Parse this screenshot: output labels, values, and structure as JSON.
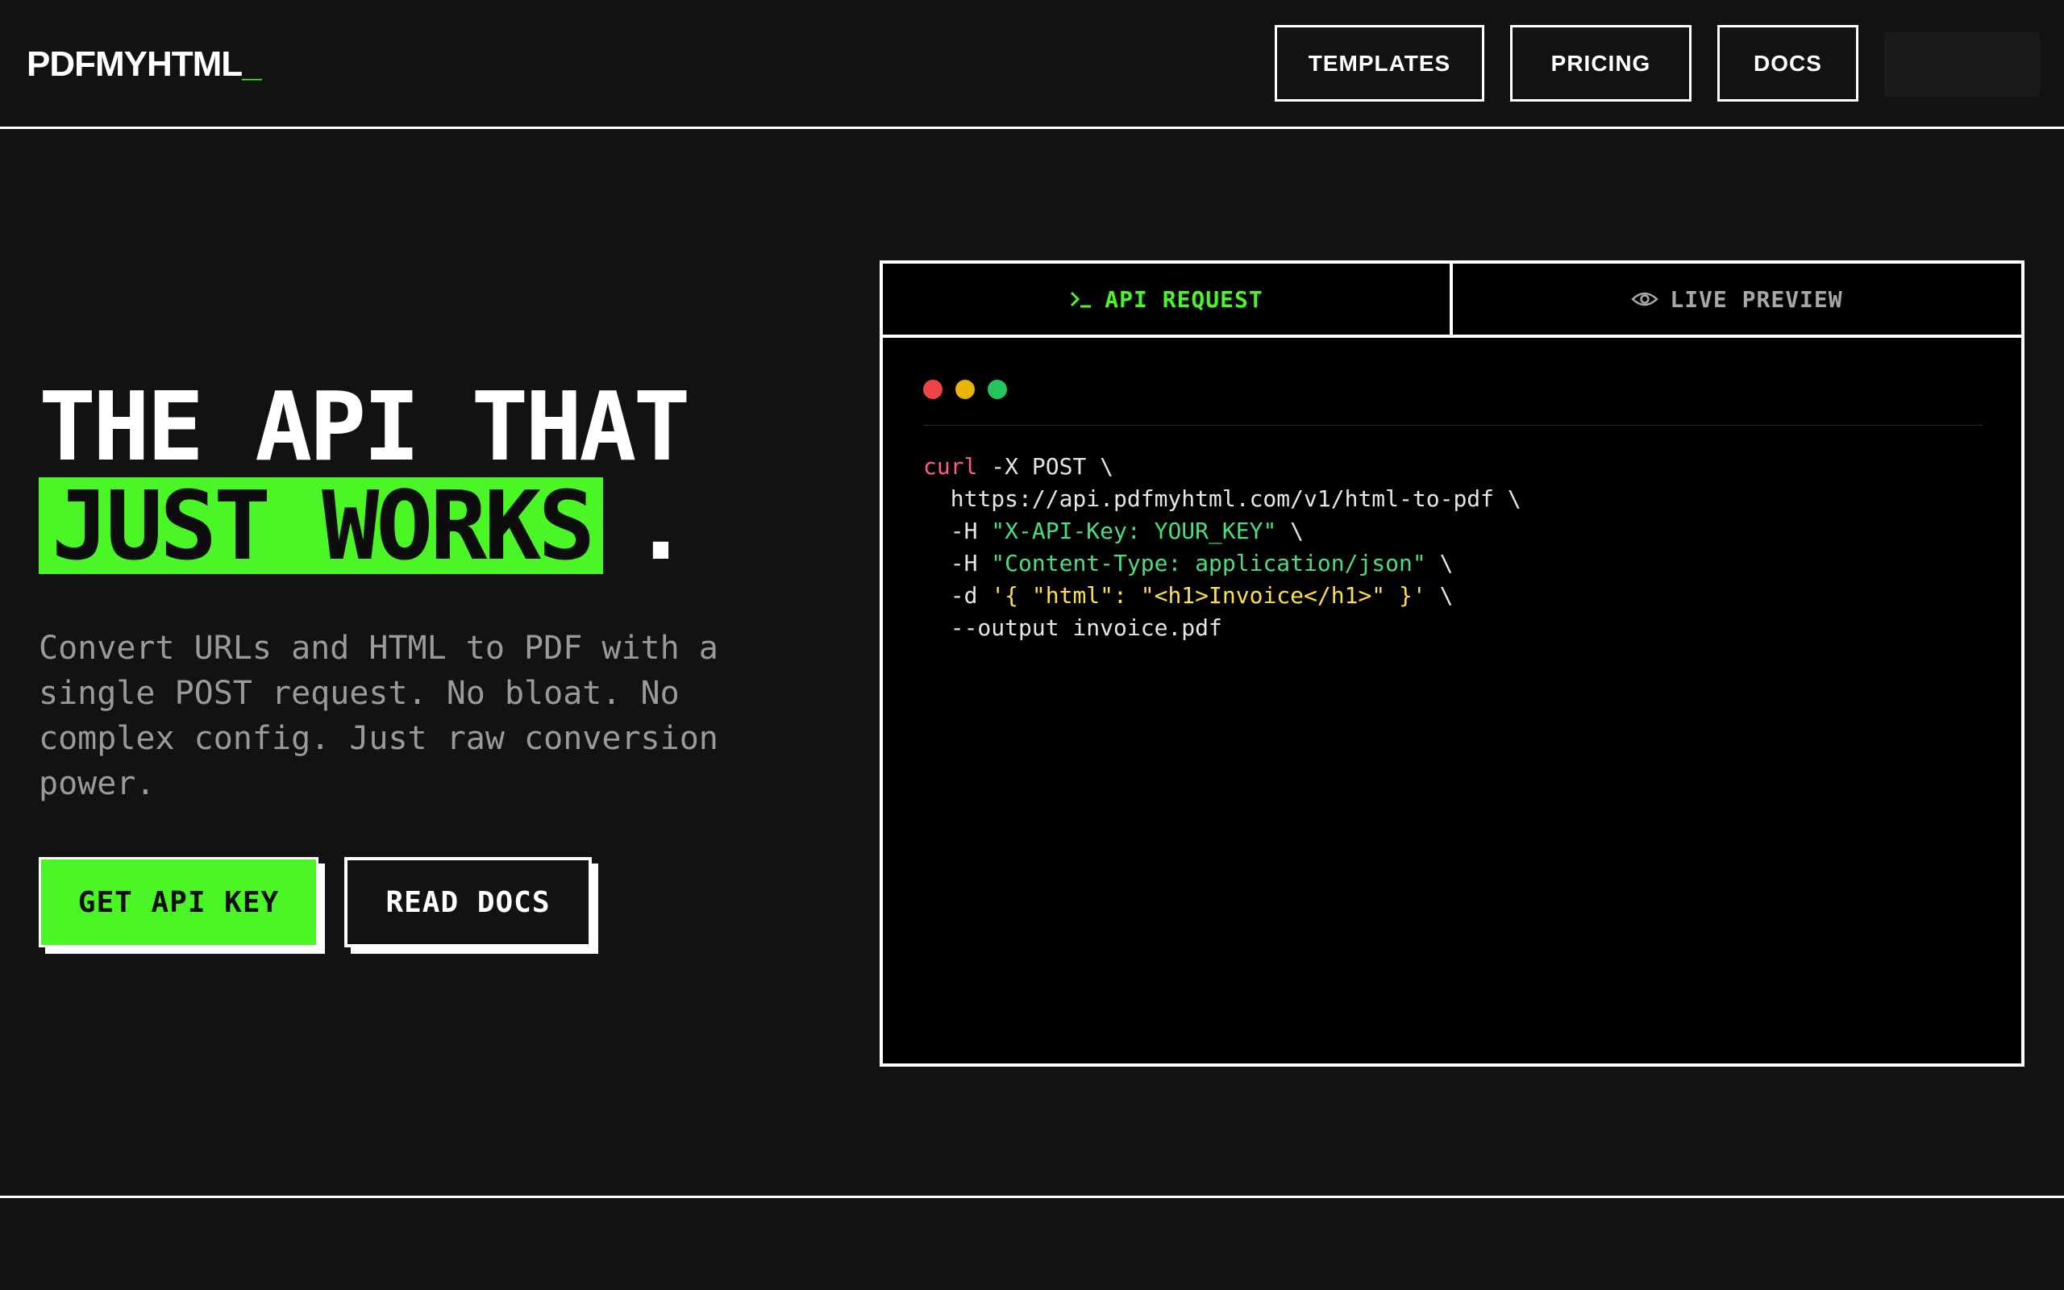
{
  "header": {
    "logo_text": "PDFMYHTML",
    "logo_cursor": "_",
    "nav": [
      "TEMPLATES",
      "PRICING",
      "DOCS"
    ]
  },
  "hero": {
    "headline_line1": "THE API THAT",
    "headline_highlight": "JUST WORKS",
    "headline_dot": ".",
    "subtext": "Convert URLs and HTML to PDF with a single POST request. No bloat. No complex config. Just raw conversion power.",
    "primary_cta": "GET API KEY",
    "secondary_cta": "READ DOCS"
  },
  "panel": {
    "tabs": [
      {
        "label": "API REQUEST",
        "icon": "terminal-icon",
        "active": true
      },
      {
        "label": "LIVE PREVIEW",
        "icon": "eye-icon",
        "active": false
      }
    ],
    "window_dots": [
      "#ef4444",
      "#eab308",
      "#22c55e"
    ],
    "code": {
      "l1_cmd": "curl",
      "l1_rest": " -X POST \\",
      "l2": "  https://api.pdfmyhtml.com/v1/html-to-pdf \\",
      "l3_flag": "  -H ",
      "l3_str": "\"X-API-Key: YOUR_KEY\"",
      "l3_end": " \\",
      "l4_flag": "  -H ",
      "l4_str": "\"Content-Type: application/json\"",
      "l4_end": " \\",
      "l5_flag": "  -d ",
      "l5_json": "'{ \"html\": \"<h1>Invoice</h1>\" }'",
      "l5_end": " \\",
      "l6": "  --output invoice.pdf"
    }
  },
  "colors": {
    "accent": "#4af626",
    "background": "#121212",
    "code_bg": "#000000",
    "code_command": "#ff5c8a",
    "code_string": "#4ade80",
    "code_json": "#fde047"
  }
}
